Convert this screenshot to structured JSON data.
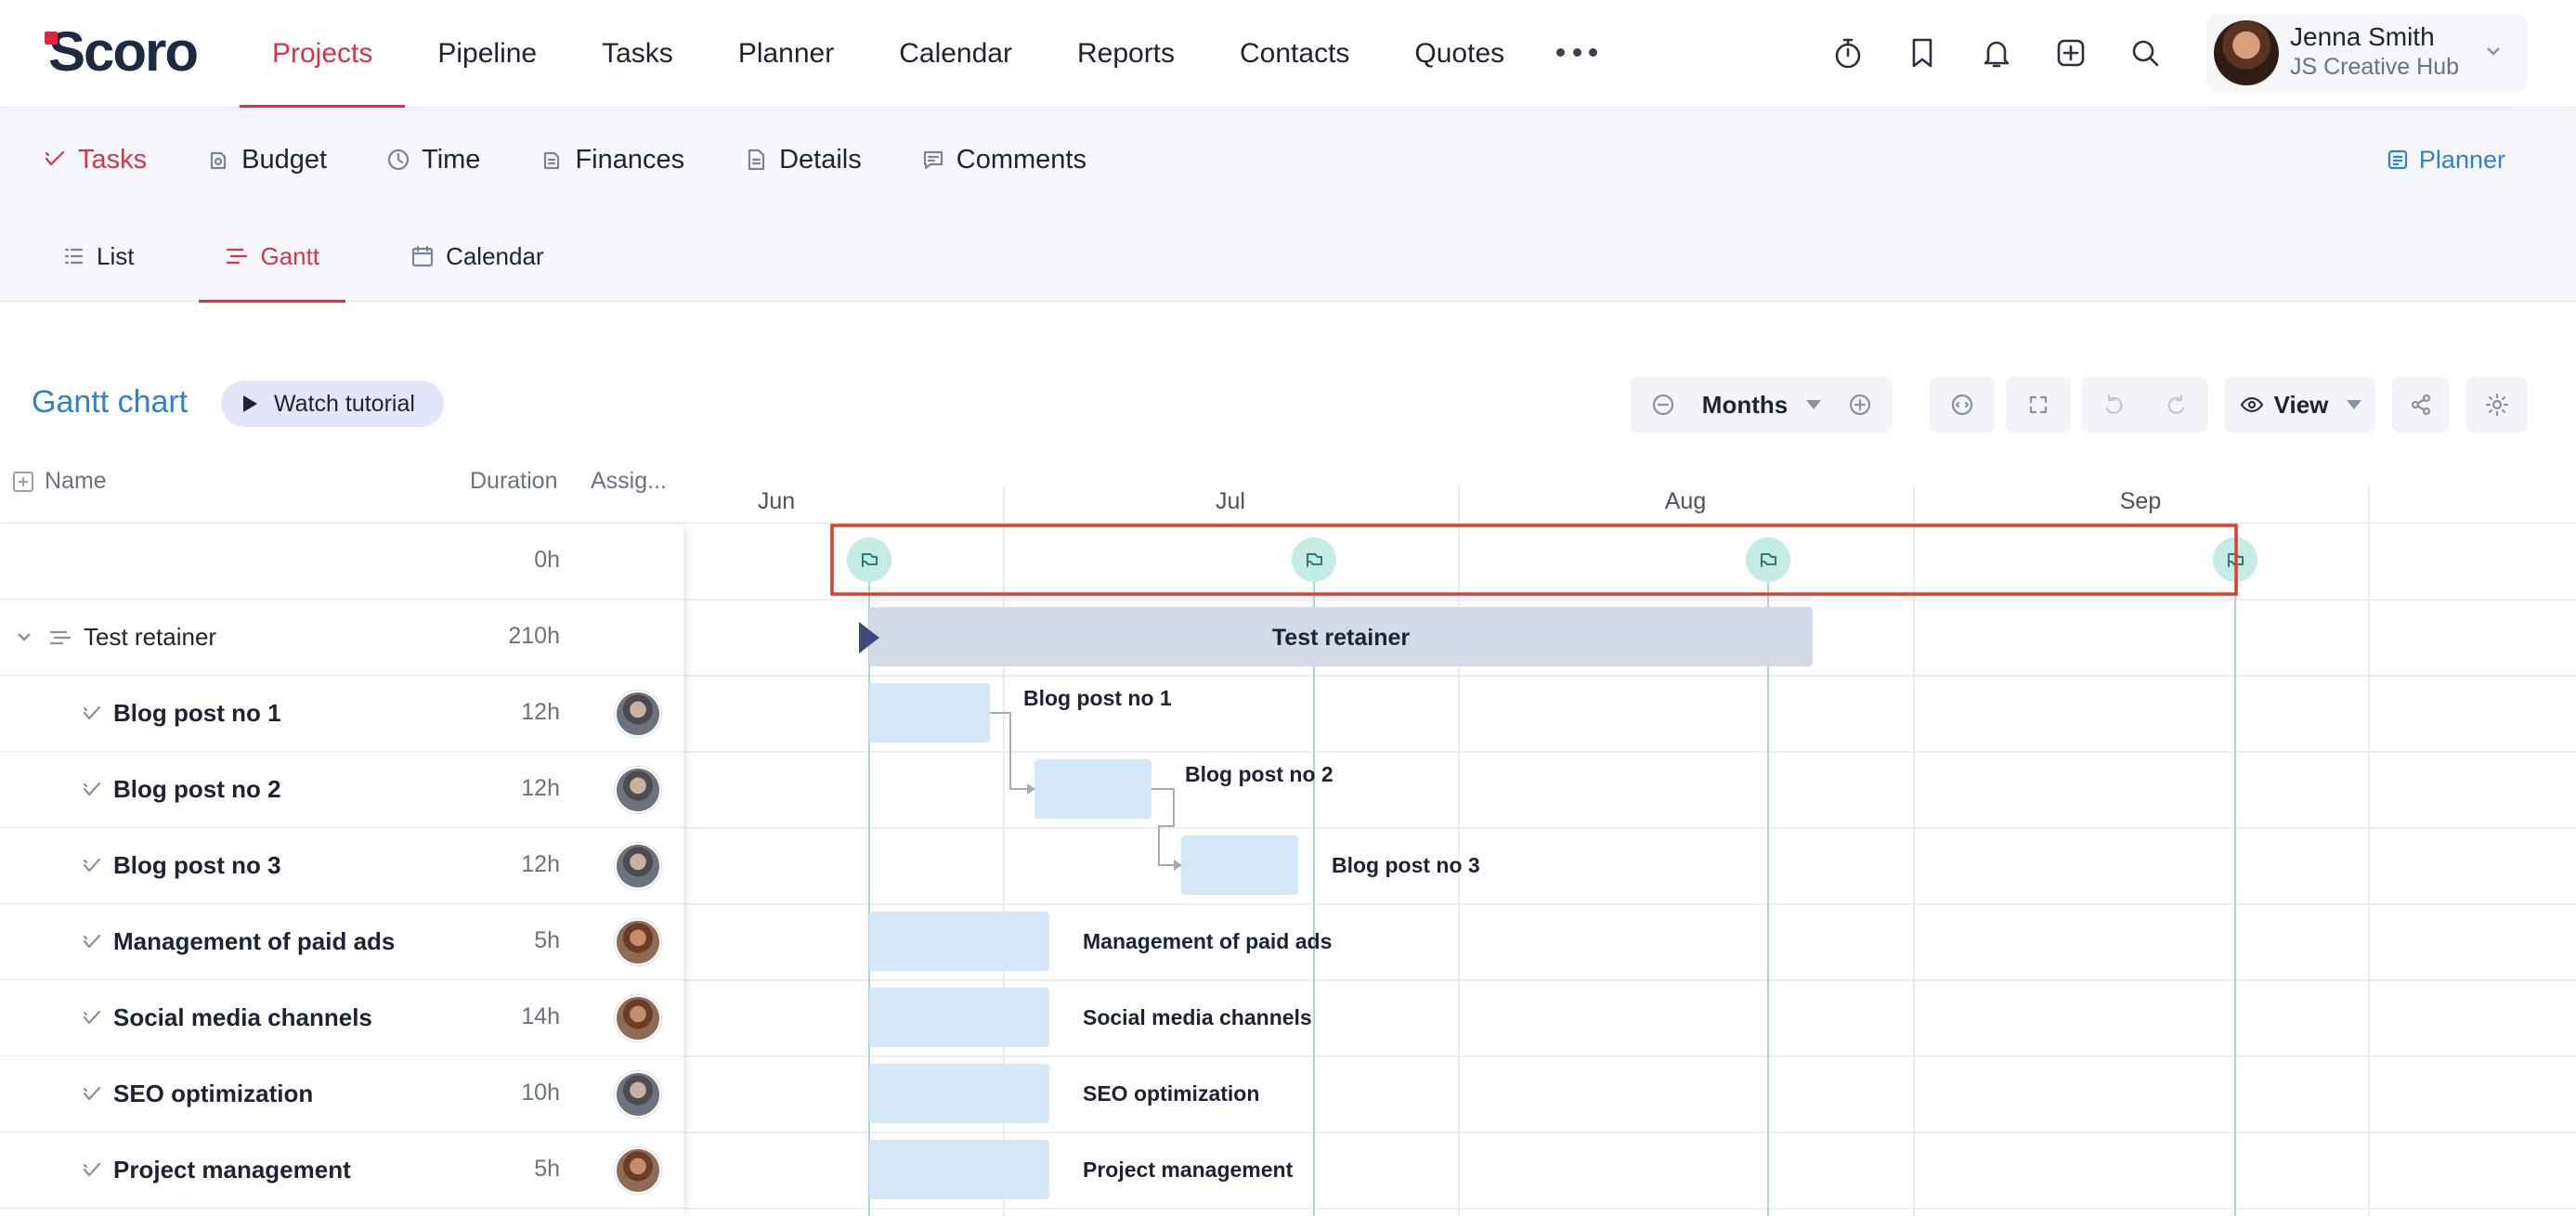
{
  "app": {
    "logo": "Scoro"
  },
  "nav": {
    "items": [
      "Projects",
      "Pipeline",
      "Tasks",
      "Planner",
      "Calendar",
      "Reports",
      "Contacts",
      "Quotes"
    ],
    "active_index": 0
  },
  "user": {
    "name": "Jenna Smith",
    "org": "JS Creative Hub"
  },
  "project_tabs": {
    "items": [
      "Tasks",
      "Budget",
      "Time",
      "Finances",
      "Details",
      "Comments"
    ],
    "icons": [
      "task-check-icon",
      "budget-icon",
      "clock-icon",
      "finances-icon",
      "document-icon",
      "comment-icon"
    ],
    "planner_label": "Planner"
  },
  "view_tabs": {
    "items": [
      "List",
      "Gantt",
      "Calendar"
    ],
    "active_index": 1
  },
  "gantt": {
    "title": "Gantt chart",
    "watch_tutorial": "Watch tutorial",
    "scale_label": "Months",
    "view_label": "View",
    "columns": {
      "name": "Name",
      "duration": "Duration",
      "assignee": "Assig..."
    },
    "months": [
      "Jun",
      "Jul",
      "Aug",
      "Sep"
    ]
  },
  "rows": [
    {
      "name": "",
      "duration": "0h",
      "type": "milestones"
    },
    {
      "name": "Test retainer",
      "duration": "210h",
      "type": "project"
    },
    {
      "name": "Blog post no 1",
      "duration": "12h",
      "type": "task",
      "avatar": "a1"
    },
    {
      "name": "Blog post no 2",
      "duration": "12h",
      "type": "task",
      "avatar": "a1"
    },
    {
      "name": "Blog post no 3",
      "duration": "12h",
      "type": "task",
      "avatar": "a1"
    },
    {
      "name": "Management of paid ads",
      "duration": "5h",
      "type": "task",
      "avatar": "a2"
    },
    {
      "name": "Social media channels",
      "duration": "14h",
      "type": "task",
      "avatar": "a2"
    },
    {
      "name": "SEO optimization",
      "duration": "10h",
      "type": "task",
      "avatar": "a1"
    },
    {
      "name": "Project management",
      "duration": "5h",
      "type": "task",
      "avatar": "a2"
    }
  ],
  "colors": {
    "accent": "#d9324a",
    "link": "#2f7fd6",
    "project_bar": "#d4d9e8",
    "task_bar": "#d4e7f6",
    "milestone": "#c4ebe4",
    "highlight_box": "#e23b2c"
  }
}
